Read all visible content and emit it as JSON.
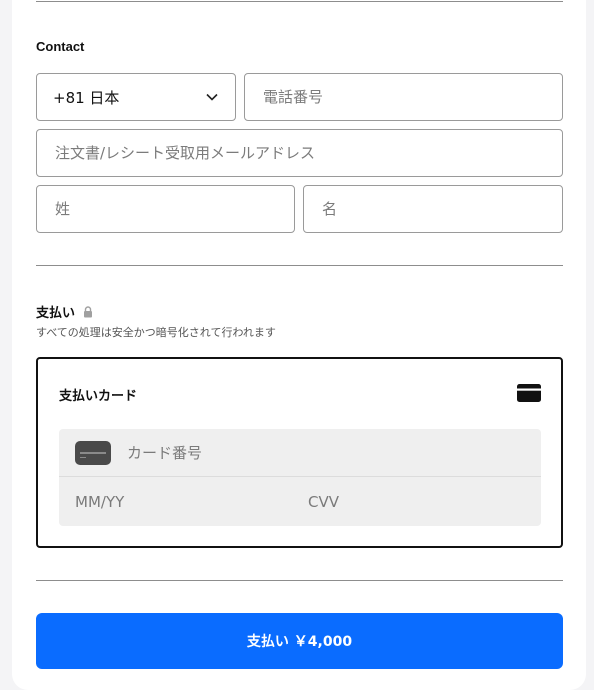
{
  "contact": {
    "title": "Contact",
    "country_code": "+81 日本",
    "phone_placeholder": "電話番号",
    "email_placeholder": "注文書/レシート受取用メールアドレス",
    "last_name_placeholder": "姓",
    "first_name_placeholder": "名"
  },
  "payment": {
    "title": "支払い",
    "subtitle": "すべての処理は安全かつ暗号化されて行われます",
    "card_box_title": "支払いカード",
    "card_number_placeholder": "カード番号",
    "expiry_placeholder": "MM/YY",
    "cvv_placeholder": "CVV"
  },
  "submit": {
    "label": "支払い ￥4,000"
  },
  "colors": {
    "accent": "#0a6cff",
    "border": "#9a9a9a",
    "card_input_bg": "#efefef"
  },
  "icons": [
    "chevron-down-icon",
    "lock-icon",
    "credit-card-icon",
    "card-chip-icon"
  ]
}
